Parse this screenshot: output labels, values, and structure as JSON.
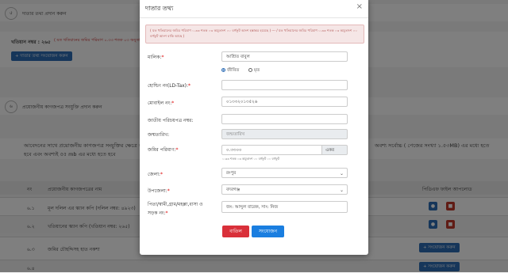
{
  "background": {
    "section5_number": "৫",
    "section5_title": "দাতার তথ্য প্রদান করুন",
    "khatian_label": "খতিয়ান নম্বর : ২৬৫",
    "khatian_note": "( যত খতিয়ানের জমির পরিমাণ ০.৩৩ শতক ০৩ অযুতাংশ ০০ বর্গফুট)",
    "add_donor_button": "+ দাতার তথ্য সংযোজন করুন",
    "section6_number": "৬",
    "section6_title": "প্রয়োজনীয় কাগজপত্র সংযুক্তি প্রদান করুন",
    "instruction_line1": "আবেদনের সাথে প্রয়োজনীয় কাগজপত্র সংযুক্তির ক্ষেত্রে অনু",
    "instruction_line1_right": "অবশ্য সর্বোচ্চ ( পেজের সংখ্যা ১.৫৩MB) এর মধ্যে হতে",
    "instruction_line2": "হবে এবং অবশ্যই ৫৫ mb এর মধ্যে হতে হবে",
    "table_col_no": "নং",
    "table_col_name": "প্রয়োজনীয় কাগজপত্রের নাম",
    "table_col_upload": "পিডিএফ ফাইল আপলোড",
    "rows": [
      {
        "no": "৬.১",
        "name": "মূল দলিল এর স্ক্যান কপি (দলিল নম্বর: ৪৯২৩)"
      },
      {
        "no": "৬.২",
        "name": "খতিয়ানের স্ক্যান কপি (খতিয়ান নম্বর: ২৬৫)"
      },
      {
        "no": "৬.৩",
        "name": "জমির চৌহদ্দিসহ হাত নকশা"
      },
      {
        "no": "৬.৪",
        "name": ""
      }
    ],
    "upload_button": "+ সংযোজন করুন",
    "eye_icon": "eye-icon",
    "trash_icon": "trash-icon"
  },
  "modal": {
    "title": "দাতার তথ্য",
    "close_icon": "×",
    "alert": "( যত খতিয়ানের জমির পরিমাণ ০.৩৩ শতক ০৩ অযুতাংশ ০০ বর্গফুট আংশ হস্তান্তর হয়েছে ) --- / যত খতিয়ানের জমির পরিমাণ ০.৩৩ শতক ০৩ অযুতাংশ ০০ বর্গফুট আংশ বাকি আছে )",
    "owner_label": "মালিক:",
    "owner_value": "আশ্রিত বাবুল",
    "alive_label": "জীবিত",
    "dead_label": "মৃত",
    "holding_label": "হোল্ডিং নং(LD-Tax):",
    "holding_value": "",
    "mobile_label": "মোবাইল নং:",
    "mobile_value": "০১৩৩২০১৩৫২৬",
    "nid_label": "জাতীয় পরিচয়পত্র নম্বর:",
    "nid_value": "",
    "dob_label": "জন্মতারিখ:",
    "dob_placeholder": "জন্মতারিখ",
    "land_label": "জমির পরিমাণ:",
    "land_value": "০.৩৩০০",
    "land_unit": "একর",
    "land_hint": "০.৩৩ শতক ০৩ অযুতাংশ ০০ বর্গফুট ০০ বর্গফুট",
    "district_label": "জেলা:",
    "district_value": "রংপুর",
    "upazila_label": "উপজেলা:",
    "upazila_value": "বদরগঞ্জ",
    "address_label_line1": "পিতা/স্বামী,গ্রাম/মহল্লা,বাসা ও",
    "address_label_line2": "সড়ক নং:",
    "address_value": "জং: আব্দুল বারেক, সাং: নিজ",
    "cancel_button": "বাতিল",
    "submit_button": "সংযোজন"
  }
}
